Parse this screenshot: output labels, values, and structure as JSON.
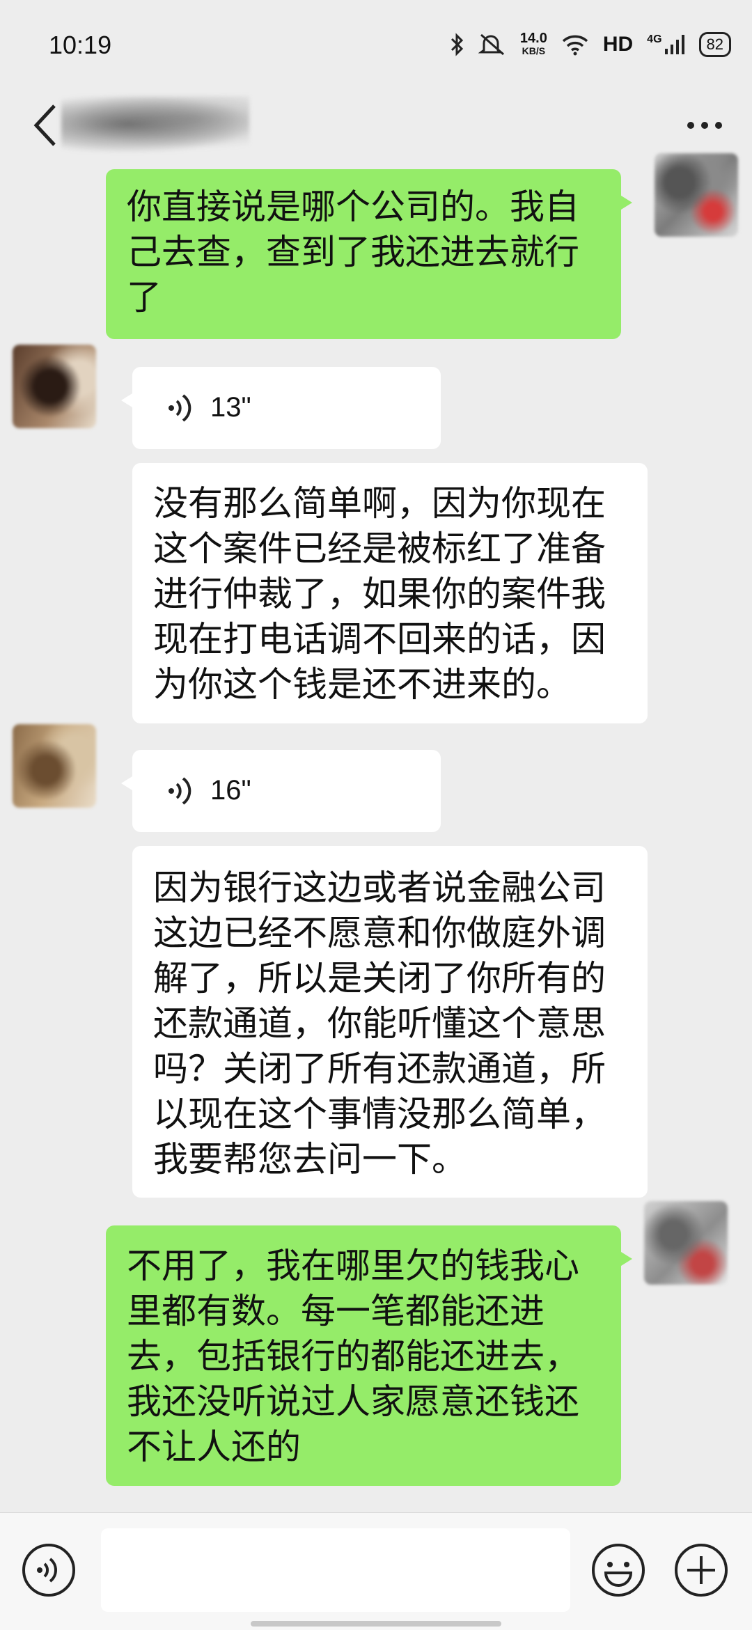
{
  "status_bar": {
    "time": "10:19",
    "speed_value": "14.0",
    "speed_unit": "KB/S",
    "hd_label": "HD",
    "network_label": "4G",
    "battery": "82"
  },
  "colors": {
    "my_bubble": "#95ec69",
    "their_bubble": "#ffffff",
    "background": "#ededed"
  },
  "messages": [
    {
      "sender": "me",
      "type": "text",
      "text": "你直接说是哪个公司的。我自己去查，查到了我还进去就行了"
    },
    {
      "sender": "other",
      "type": "voice",
      "duration": "13\""
    },
    {
      "sender": "other",
      "type": "text",
      "text": "没有那么简单啊，因为你现在这个案件已经是被标红了准备进行仲裁了，如果你的案件我现在打电话调不回来的话，因为你这个钱是还不进来的。"
    },
    {
      "sender": "other",
      "type": "voice",
      "duration": "16\""
    },
    {
      "sender": "other",
      "type": "text",
      "text": "因为银行这边或者说金融公司这边已经不愿意和你做庭外调解了，所以是关闭了你所有的还款通道，你能听懂这个意思吗？关闭了所有还款通道，所以现在这个事情没那么简单，我要帮您去问一下。"
    },
    {
      "sender": "me",
      "type": "text",
      "text": "不用了，我在哪里欠的钱我心里都有数。每一笔都能还进去，包括银行的都能还进去，我还没听说过人家愿意还钱还不让人还的"
    }
  ],
  "icons": {
    "back": "chevron-left-icon",
    "more": "more-dots-icon",
    "voice_input": "voice-input-icon",
    "emoji": "emoji-icon",
    "plus": "plus-icon"
  }
}
